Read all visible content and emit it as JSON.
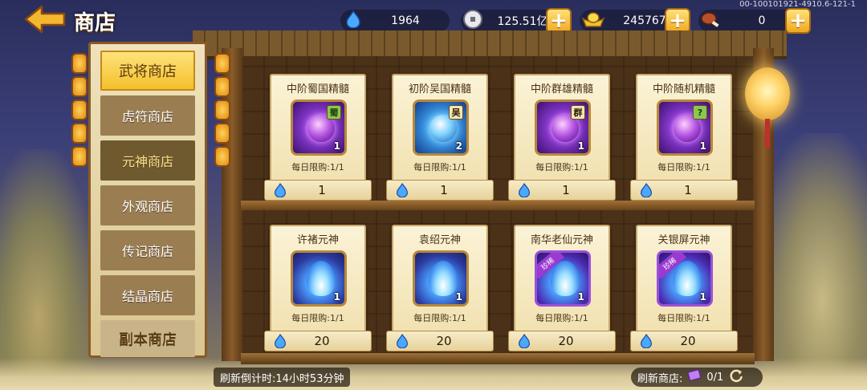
{
  "header": {
    "title": "商店",
    "version": "00-100101921-4910.6-121-1"
  },
  "resources": [
    {
      "name": "blue-soul",
      "value": "1964"
    },
    {
      "name": "silver",
      "value": "125.51亿"
    },
    {
      "name": "gold-ingot",
      "value": "245767"
    },
    {
      "name": "meat",
      "value": "0"
    }
  ],
  "sidebar": {
    "tabs": [
      {
        "label": "武将商店",
        "state": "active"
      },
      {
        "label": "虎符商店",
        "state": "normal"
      },
      {
        "label": "元神商店",
        "state": "selected"
      },
      {
        "label": "外观商店",
        "state": "normal"
      },
      {
        "label": "传记商店",
        "state": "normal"
      },
      {
        "label": "结晶商店",
        "state": "normal"
      },
      {
        "label": "副本商店",
        "state": "partial"
      }
    ]
  },
  "items": [
    {
      "name": "中阶蜀国精髓",
      "badge": "蜀",
      "count": "1",
      "limit": "每日限购:1/1",
      "price": "1",
      "icon": "purple-orb",
      "rare": ""
    },
    {
      "name": "初阶吴国精髓",
      "badge": "吴",
      "count": "2",
      "limit": "每日限购:1/1",
      "price": "1",
      "icon": "blue-orb",
      "rare": ""
    },
    {
      "name": "中阶群雄精髓",
      "badge": "群",
      "count": "1",
      "limit": "每日限购:1/1",
      "price": "1",
      "icon": "purple-orb",
      "rare": ""
    },
    {
      "name": "中阶随机精髓",
      "badge": "?",
      "count": "1",
      "limit": "每日限购:1/1",
      "price": "1",
      "icon": "purple-orb",
      "rare": ""
    },
    {
      "name": "许褚元神",
      "badge": "",
      "count": "1",
      "limit": "每日限购:1/1",
      "price": "20",
      "icon": "blue-flame",
      "rare": ""
    },
    {
      "name": "袁绍元神",
      "badge": "",
      "count": "1",
      "limit": "每日限购:1/1",
      "price": "20",
      "icon": "blue-flame",
      "rare": ""
    },
    {
      "name": "南华老仙元神",
      "badge": "",
      "count": "1",
      "limit": "每日限购:1/1",
      "price": "20",
      "icon": "blue-flame",
      "rare": "珍稀"
    },
    {
      "name": "关银屏元神",
      "badge": "",
      "count": "1",
      "limit": "每日限购:1/1",
      "price": "20",
      "icon": "blue-flame",
      "rare": "珍稀"
    }
  ],
  "footer": {
    "timer": "刷新倒计时:14小时53分钟",
    "refresh_label": "刷新商店:",
    "refresh_count": "0/1"
  },
  "colors": {
    "accent_gold": "#f4c02c",
    "soul_blue": "#3a8af0",
    "rare_purple": "#9a3ad0"
  }
}
